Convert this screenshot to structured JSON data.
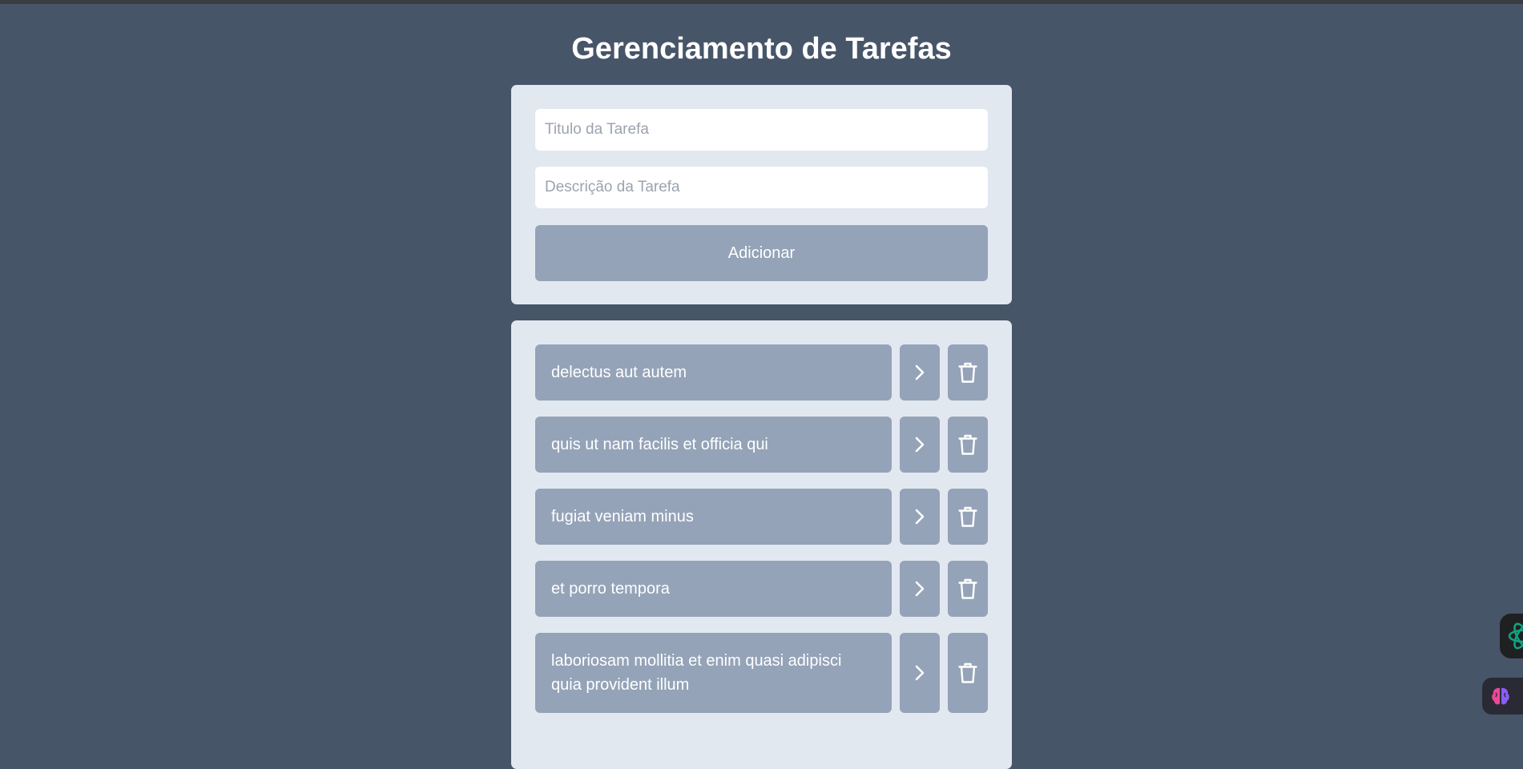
{
  "page": {
    "title": "Gerenciamento de Tarefas"
  },
  "form": {
    "title_placeholder": "Titulo da Tarefa",
    "title_value": "",
    "description_placeholder": "Descrição da Tarefa",
    "description_value": "",
    "add_label": "Adicionar"
  },
  "tasks": [
    {
      "title": "delectus aut autem"
    },
    {
      "title": "quis ut nam facilis et officia qui"
    },
    {
      "title": "fugiat veniam minus"
    },
    {
      "title": "et porro tempora"
    },
    {
      "title": "laboriosam mollitia et enim quasi adipisci quia provident illum"
    }
  ],
  "icons": {
    "details": "chevron-right-icon",
    "delete": "trash-icon",
    "assistant_1": "ai-assistant-icon",
    "assistant_2": "brain-icon"
  },
  "colors": {
    "background": "#475569",
    "card": "#e2e8f0",
    "button": "#94a3b8",
    "text_light": "#ffffff"
  }
}
